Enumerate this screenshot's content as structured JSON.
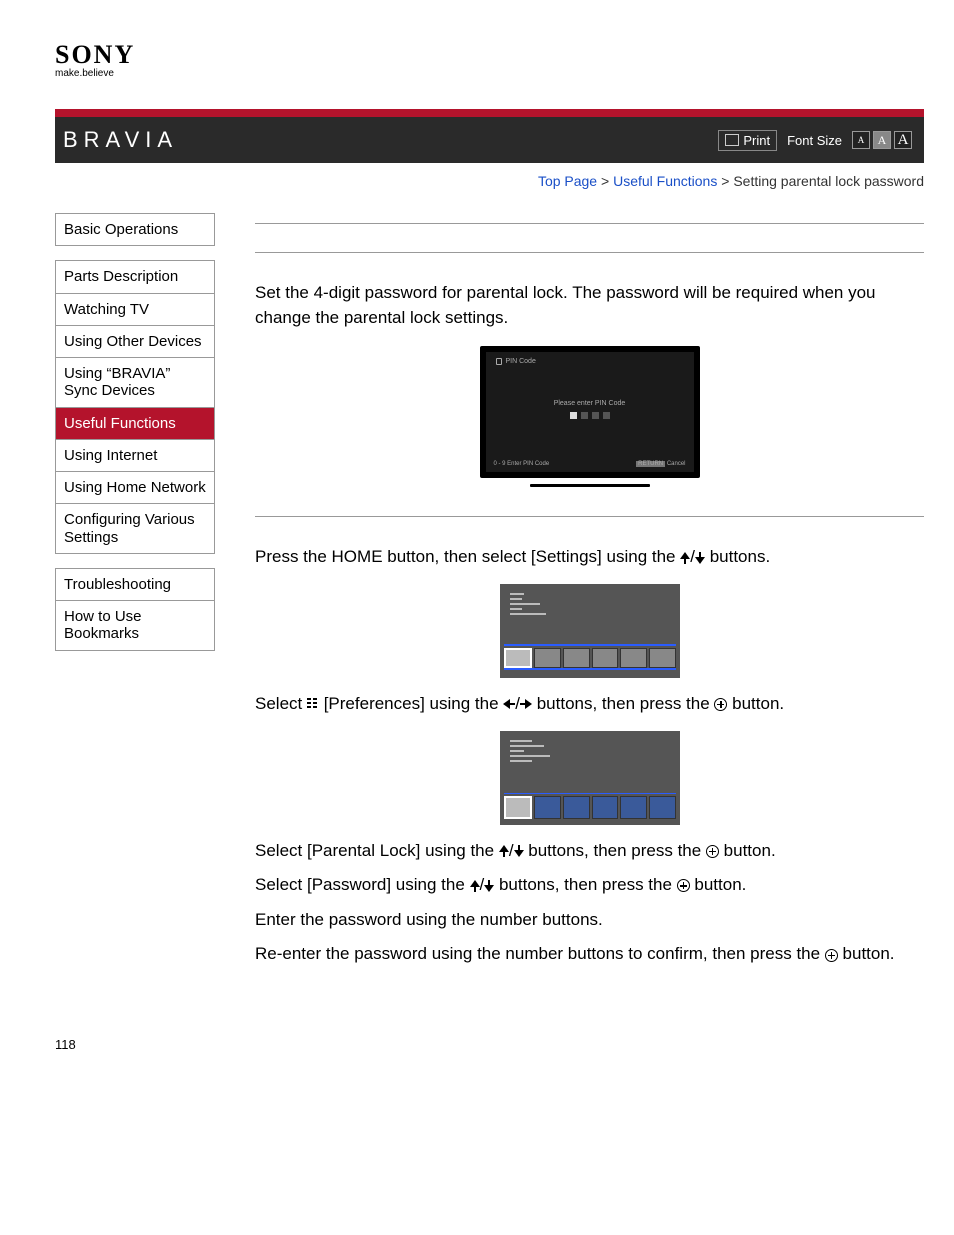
{
  "brand": {
    "logo": "SONY",
    "tagline": "make.believe",
    "product": "BRAVIA"
  },
  "header": {
    "print": "Print",
    "font_size_label": "Font Size"
  },
  "breadcrumb": {
    "top": "Top Page",
    "sep": ">",
    "cat": "Useful Functions",
    "current": "Setting parental lock password"
  },
  "sidebar": {
    "group1": [
      "Basic Operations"
    ],
    "group2": [
      "Parts Description",
      "Watching TV",
      "Using Other Devices",
      "Using “BRAVIA” Sync Devices",
      "Useful Functions",
      "Using Internet",
      "Using Home Network",
      "Configuring Various Settings"
    ],
    "group3": [
      "Troubleshooting",
      "How to Use Bookmarks"
    ],
    "active": "Useful Functions"
  },
  "content": {
    "intro": "Set the 4-digit password for parental lock. The password will be required when you change the parental lock settings.",
    "tv": {
      "title": "PIN Code",
      "msg": "Please enter PIN Code",
      "foot_left": "0 - 9 Enter PIN Code",
      "foot_right_a": "RETURN",
      "foot_right_b": "Cancel"
    },
    "step1_a": "Press the HOME button, then select [Settings] using the ",
    "step1_b": " buttons.",
    "step2_a": "Select ",
    "step2_b": " [Preferences] using the ",
    "step2_c": " buttons, then press the ",
    "step2_d": " button.",
    "step3_a": "Select [Parental Lock] using the ",
    "step3_b": " buttons, then press the ",
    "step3_c": " button.",
    "step4_a": "Select [Password] using the ",
    "step4_b": " buttons, then press the ",
    "step4_c": " button.",
    "step5": "Enter the password using the number buttons.",
    "step6_a": "Re-enter the password using the number buttons to confirm, then press the ",
    "step6_b": " button."
  },
  "page_number": "118"
}
